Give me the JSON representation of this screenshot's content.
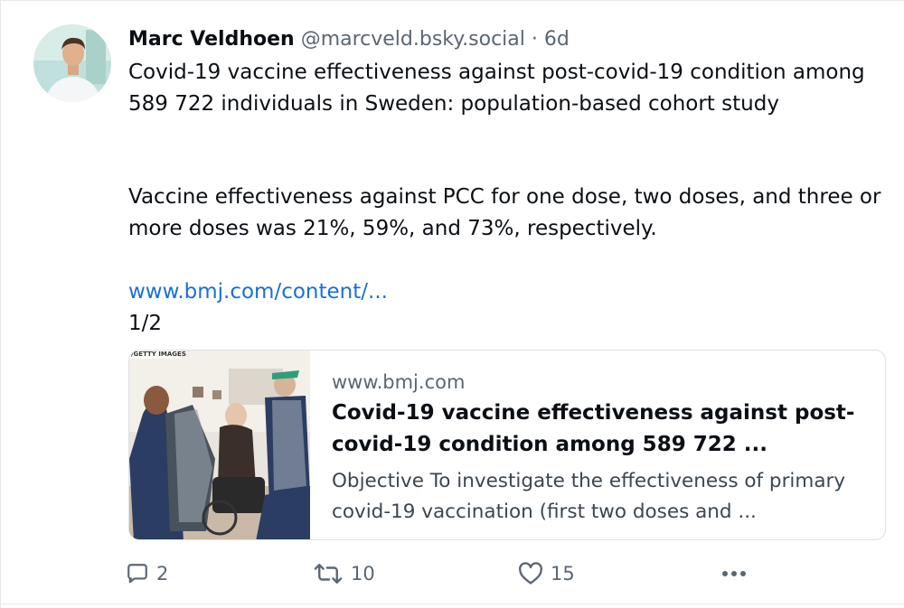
{
  "post": {
    "author": {
      "display_name": "Marc Veldhoen",
      "handle": "@marcveld.bsky.social",
      "separator": "·",
      "time": "6d"
    },
    "text": {
      "line1": "Covid-19 vaccine effectiveness against post-covid-19 condition among 589 722 individuals in Sweden: population-based cohort study",
      "line2": "Vaccine effectiveness against PCC for one dose, two doses, and three or more doses was 21%, 59%, and 73%, respectively.",
      "link": "www.bmj.com/content/...",
      "thread_count": "1/2"
    },
    "link_card": {
      "image_credit": "/GETTY IMAGES",
      "domain": "www.bmj.com",
      "title": "Covid-19 vaccine effectiveness against post-covid-19 condition among 589 722 ...",
      "description": "Objective To investigate the effectiveness of primary covid-19 vaccination (first two doses and ..."
    },
    "actions": {
      "replies": "2",
      "reposts": "10",
      "likes": "15"
    },
    "icons": {
      "reply": "speech-bubble-icon",
      "repost": "repost-arrows-icon",
      "like": "heart-icon",
      "more": "ellipsis-icon"
    },
    "colors": {
      "link": "#1a70d6",
      "muted": "#5b6673",
      "text": "#0b0f14",
      "border": "#e6e9ed"
    }
  }
}
